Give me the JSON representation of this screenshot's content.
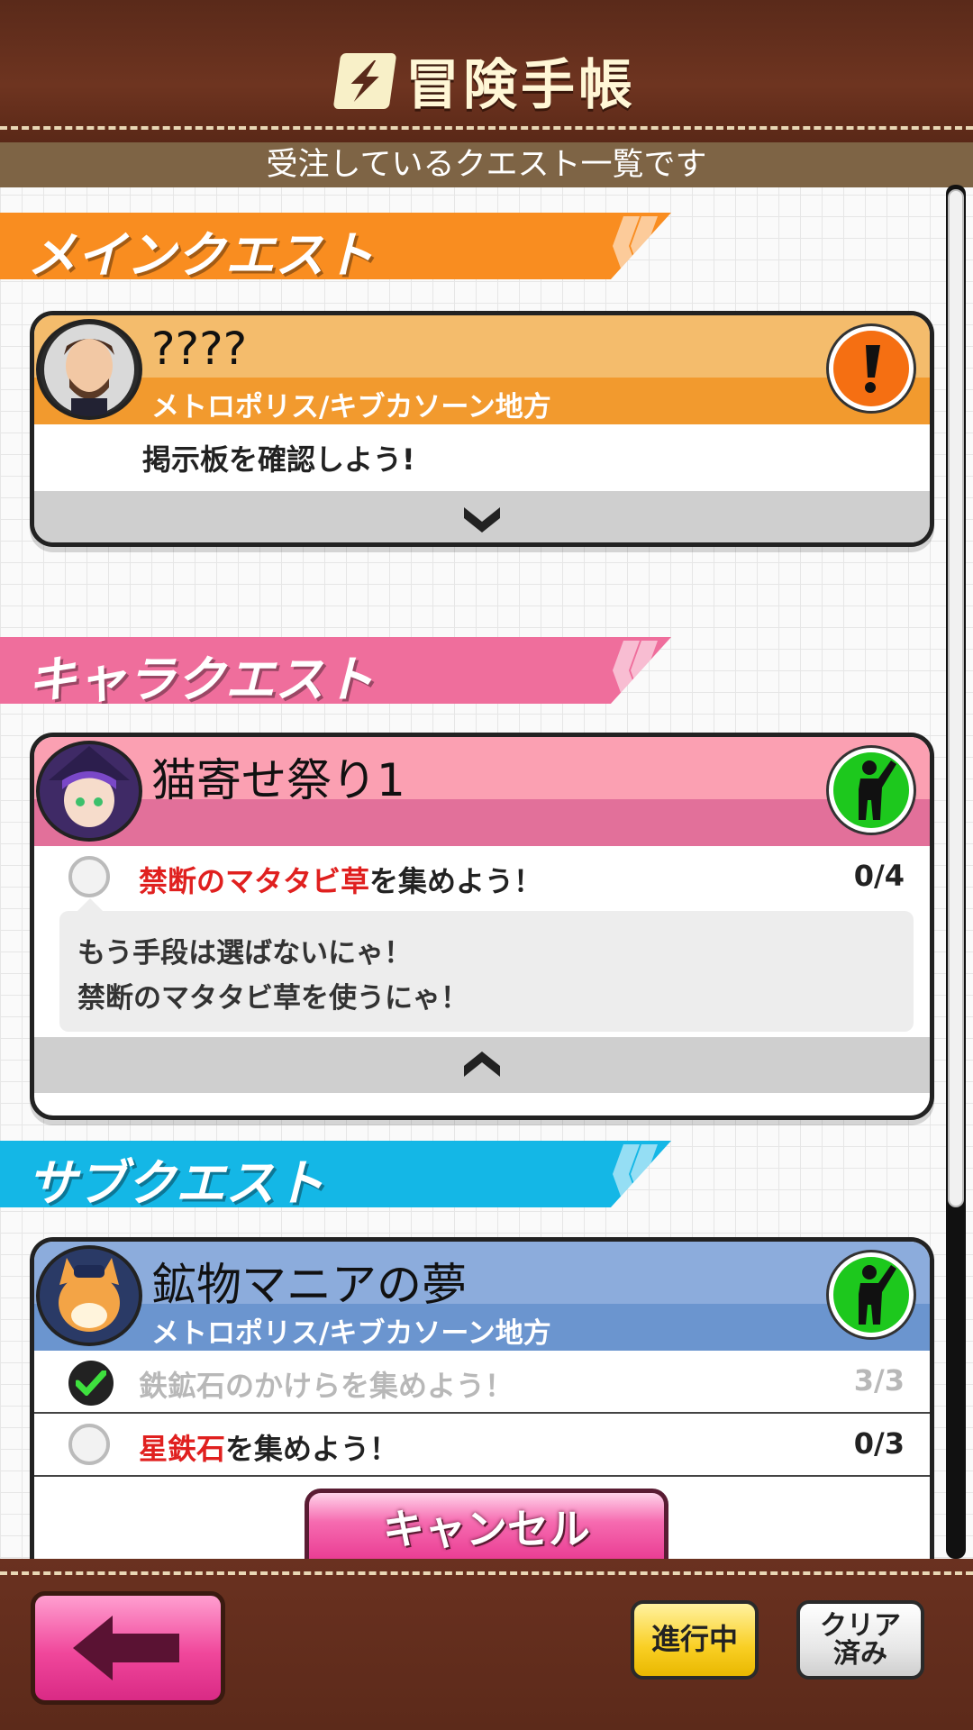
{
  "header": {
    "title": "冒険手帳",
    "subtitle": "受注しているクエスト一覧です"
  },
  "sections": {
    "main": {
      "label": "メインクエスト",
      "color": "#f98d20"
    },
    "character": {
      "label": "キャラクエスト",
      "color": "#ef6e9c"
    },
    "sub": {
      "label": "サブクエスト",
      "color": "#14b7e6"
    }
  },
  "main_quest": {
    "title": "????",
    "region": "メトロポリス/キブカソーン地方",
    "description": "掲示板を確認しよう!",
    "status_icon": "exclamation-icon",
    "expand_icon": "chevron-down-icon"
  },
  "character_quest": {
    "title": "猫寄せ祭り1",
    "task_highlight": "禁断のマタタビ草",
    "task_rest": "を集めよう！",
    "progress": "0/4",
    "dialogue_line1": "もう手段は選ばないにゃ！",
    "dialogue_line2": "禁断のマタタビ草を使うにゃ！",
    "status_icon": "in-progress-person-icon",
    "collapse_icon": "chevron-up-icon"
  },
  "sub_quest": {
    "title": "鉱物マニアの夢",
    "region": "メトロポリス/キブカソーン地方",
    "task1_text": "鉄鉱石のかけらを集めよう！",
    "task1_progress": "3/3",
    "task2_highlight": "星鉄石",
    "task2_rest": "を集めよう！",
    "task2_progress": "0/3",
    "cancel_label": "キャンセル",
    "status_icon": "in-progress-person-icon"
  },
  "footer": {
    "back_icon": "back-arrow-icon",
    "in_progress_label": "進行中",
    "cleared_label": "クリア\n済み"
  }
}
